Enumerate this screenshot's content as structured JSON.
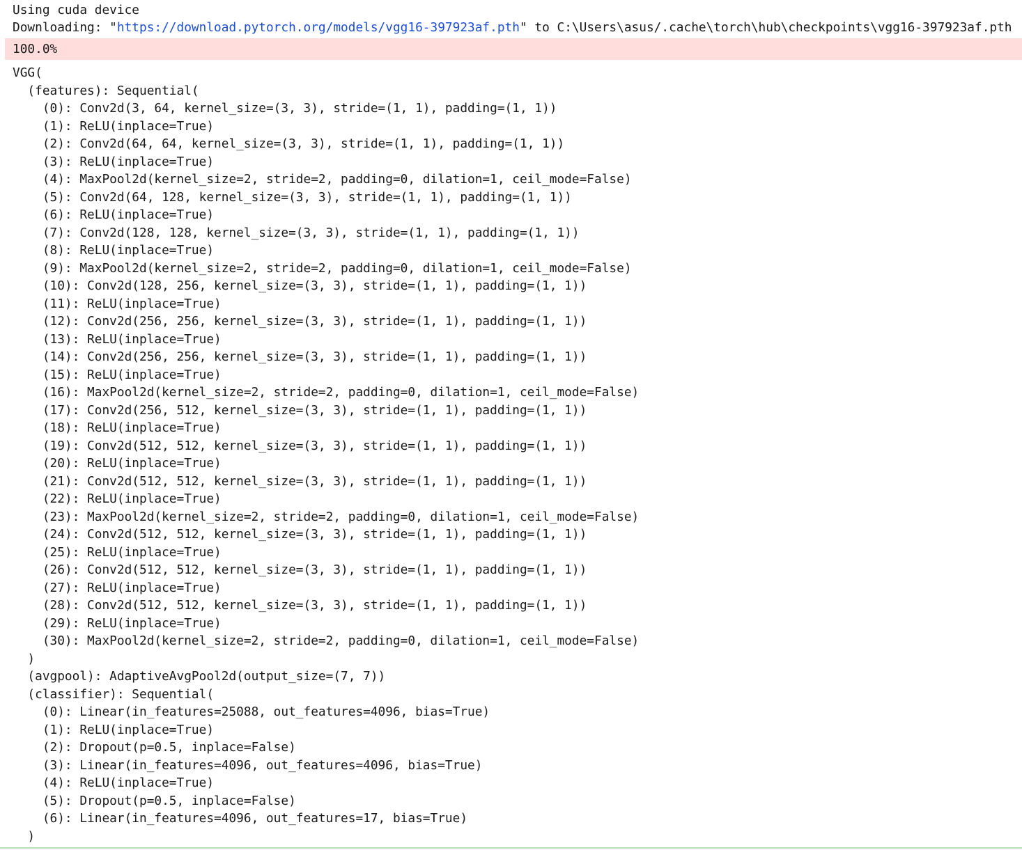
{
  "output": {
    "device_line": "Using cuda device",
    "download": {
      "prefix": "Downloading: \"",
      "url": "https://download.pytorch.org/models/vgg16-397923af.pth",
      "suffix": "\" to C:\\Users\\asus/.cache\\torch\\hub\\checkpoints\\vgg16-397923af.pth"
    },
    "progress": "100.0%",
    "model_lines": [
      "VGG(",
      "  (features): Sequential(",
      "    (0): Conv2d(3, 64, kernel_size=(3, 3), stride=(1, 1), padding=(1, 1))",
      "    (1): ReLU(inplace=True)",
      "    (2): Conv2d(64, 64, kernel_size=(3, 3), stride=(1, 1), padding=(1, 1))",
      "    (3): ReLU(inplace=True)",
      "    (4): MaxPool2d(kernel_size=2, stride=2, padding=0, dilation=1, ceil_mode=False)",
      "    (5): Conv2d(64, 128, kernel_size=(3, 3), stride=(1, 1), padding=(1, 1))",
      "    (6): ReLU(inplace=True)",
      "    (7): Conv2d(128, 128, kernel_size=(3, 3), stride=(1, 1), padding=(1, 1))",
      "    (8): ReLU(inplace=True)",
      "    (9): MaxPool2d(kernel_size=2, stride=2, padding=0, dilation=1, ceil_mode=False)",
      "    (10): Conv2d(128, 256, kernel_size=(3, 3), stride=(1, 1), padding=(1, 1))",
      "    (11): ReLU(inplace=True)",
      "    (12): Conv2d(256, 256, kernel_size=(3, 3), stride=(1, 1), padding=(1, 1))",
      "    (13): ReLU(inplace=True)",
      "    (14): Conv2d(256, 256, kernel_size=(3, 3), stride=(1, 1), padding=(1, 1))",
      "    (15): ReLU(inplace=True)",
      "    (16): MaxPool2d(kernel_size=2, stride=2, padding=0, dilation=1, ceil_mode=False)",
      "    (17): Conv2d(256, 512, kernel_size=(3, 3), stride=(1, 1), padding=(1, 1))",
      "    (18): ReLU(inplace=True)",
      "    (19): Conv2d(512, 512, kernel_size=(3, 3), stride=(1, 1), padding=(1, 1))",
      "    (20): ReLU(inplace=True)",
      "    (21): Conv2d(512, 512, kernel_size=(3, 3), stride=(1, 1), padding=(1, 1))",
      "    (22): ReLU(inplace=True)",
      "    (23): MaxPool2d(kernel_size=2, stride=2, padding=0, dilation=1, ceil_mode=False)",
      "    (24): Conv2d(512, 512, kernel_size=(3, 3), stride=(1, 1), padding=(1, 1))",
      "    (25): ReLU(inplace=True)",
      "    (26): Conv2d(512, 512, kernel_size=(3, 3), stride=(1, 1), padding=(1, 1))",
      "    (27): ReLU(inplace=True)",
      "    (28): Conv2d(512, 512, kernel_size=(3, 3), stride=(1, 1), padding=(1, 1))",
      "    (29): ReLU(inplace=True)",
      "    (30): MaxPool2d(kernel_size=2, stride=2, padding=0, dilation=1, ceil_mode=False)",
      "  )",
      "  (avgpool): AdaptiveAvgPool2d(output_size=(7, 7))",
      "  (classifier): Sequential(",
      "    (0): Linear(in_features=25088, out_features=4096, bias=True)",
      "    (1): ReLU(inplace=True)",
      "    (2): Dropout(p=0.5, inplace=False)",
      "    (3): Linear(in_features=4096, out_features=4096, bias=True)",
      "    (4): ReLU(inplace=True)",
      "    (5): Dropout(p=0.5, inplace=False)",
      "    (6): Linear(in_features=4096, out_features=17, bias=True)",
      "  )"
    ],
    "colors": {
      "link": "#1c4fd6",
      "stderr_background": "#ffdddd",
      "text": "#1a1a1a"
    }
  }
}
